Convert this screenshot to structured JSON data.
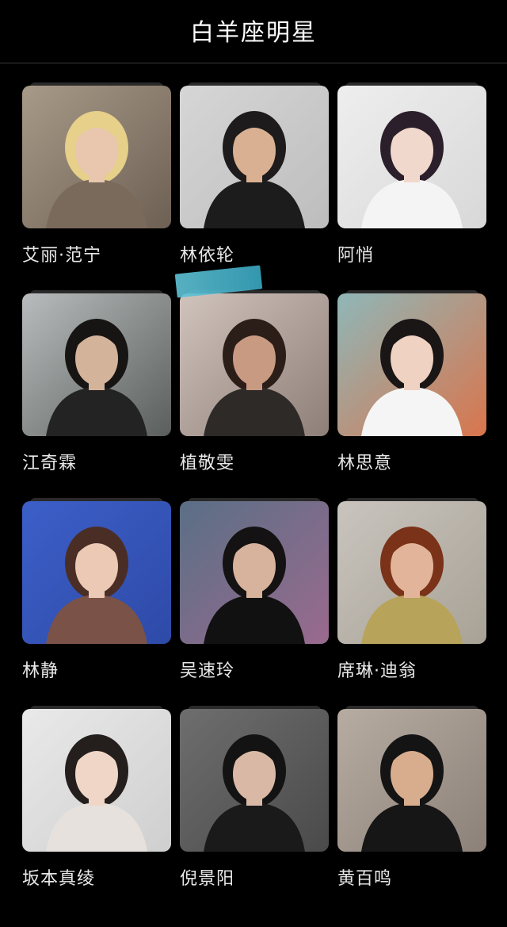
{
  "header": {
    "title": "白羊座明星"
  },
  "celebrities": [
    {
      "name": "艾丽·范宁",
      "bg": "#a89a88",
      "bg2": "#6d6054",
      "skin": "#e8c7ae",
      "hair": "#e6d08a",
      "cloth": "#7a6a5c"
    },
    {
      "name": "林依轮",
      "bg": "#d6d6d6",
      "bg2": "#bdbdbd",
      "skin": "#d9b091",
      "hair": "#1d1b1b",
      "cloth": "#1c1c1c"
    },
    {
      "name": "阿悄",
      "bg": "#eeeeee",
      "bg2": "#d8d8d8",
      "skin": "#f0d8cc",
      "hair": "#2a1f2a",
      "cloth": "#f4f4f4"
    },
    {
      "name": "江奇霖",
      "bg": "#b8bcbc",
      "bg2": "#5a5e5c",
      "skin": "#d4b39b",
      "hair": "#171514",
      "cloth": "#232323"
    },
    {
      "name": "植敬雯",
      "bg": "#d0c3bc",
      "bg2": "#8e7f78",
      "skin": "#c99a82",
      "hair": "#2b1e19",
      "cloth": "#2e2a28"
    },
    {
      "name": "林思意",
      "bg": "#8fb7b8",
      "bg2": "#d9754c",
      "skin": "#f0d2c2",
      "hair": "#1a1616",
      "cloth": "#f5f5f5"
    },
    {
      "name": "林静",
      "bg": "#3c5fc8",
      "bg2": "#2e4aa8",
      "skin": "#ecc9b4",
      "hair": "#4a2e26",
      "cloth": "#7a5248"
    },
    {
      "name": "吴速玲",
      "bg": "#5a6f86",
      "bg2": "#9a6a8e",
      "skin": "#d7b29c",
      "hair": "#141212",
      "cloth": "#111111"
    },
    {
      "name": "席琳·迪翁",
      "bg": "#c9c4be",
      "bg2": "#a8a296",
      "skin": "#e2b59a",
      "hair": "#7a3218",
      "cloth": "#b7a45a"
    },
    {
      "name": "坂本真绫",
      "bg": "#e9e9e9",
      "bg2": "#cfcfcf",
      "skin": "#f0d6c6",
      "hair": "#241e1c",
      "cloth": "#e6e1dd"
    },
    {
      "name": "倪景阳",
      "bg": "#6e6e6e",
      "bg2": "#4a4a4a",
      "skin": "#d9b9a6",
      "hair": "#131313",
      "cloth": "#1a1a1a"
    },
    {
      "name": "黄百鸣",
      "bg": "#b7aca2",
      "bg2": "#8c8178",
      "skin": "#d8ad8e",
      "hair": "#141414",
      "cloth": "#161616"
    }
  ]
}
